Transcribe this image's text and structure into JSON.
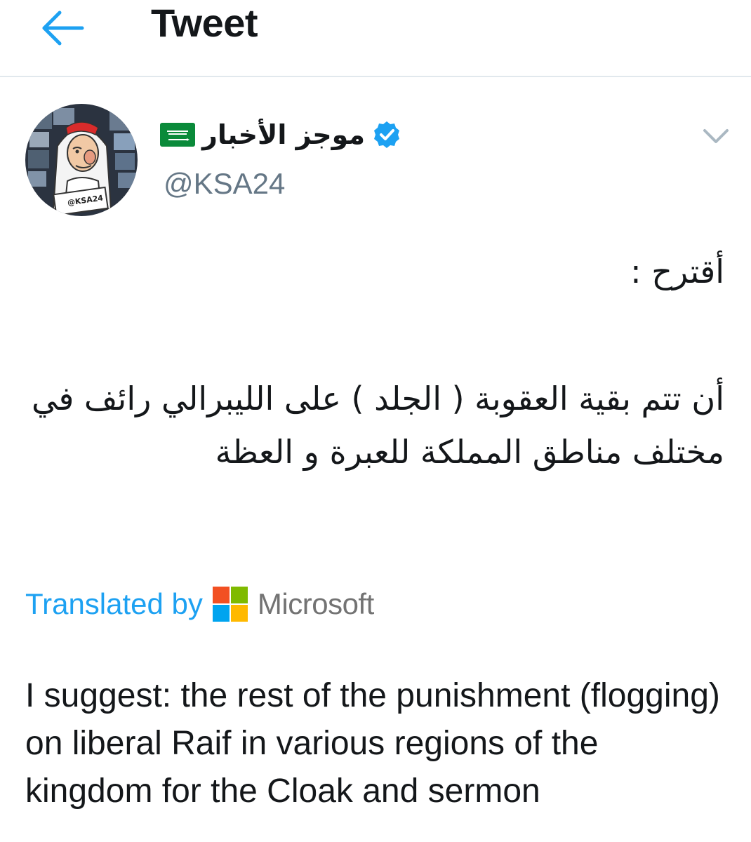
{
  "header": {
    "title": "Tweet"
  },
  "author": {
    "display_name": "موجز الأخبار",
    "handle": "@KSA24",
    "verified": true,
    "flag": "saudi-arabia-flag",
    "avatar_label": "@KSA24"
  },
  "tweet": {
    "line1": "أقترح :",
    "body": "أن تتم بقية العقوبة ( الجلد ) على الليبرالي رائف في مختلف مناطق المملكة للعبرة و العظة"
  },
  "translation": {
    "label": "Translated by",
    "provider": "Microsoft",
    "text": "I suggest: the rest of the punishment (flogging) on liberal Raif in various regions of the kingdom for the Cloak and sermon"
  },
  "colors": {
    "accent": "#1da1f2",
    "text": "#14171a",
    "secondary": "#657786",
    "divider": "#e1e8ed",
    "ms_red": "#f25022",
    "ms_green": "#7fba00",
    "ms_blue": "#00a4ef",
    "ms_yellow": "#ffb900"
  },
  "icons": {
    "back": "arrow-left-icon",
    "verified": "verified-badge-icon",
    "caret": "chevron-down-icon",
    "flag": "saudi-flag-icon",
    "microsoft": "microsoft-logo-icon"
  }
}
